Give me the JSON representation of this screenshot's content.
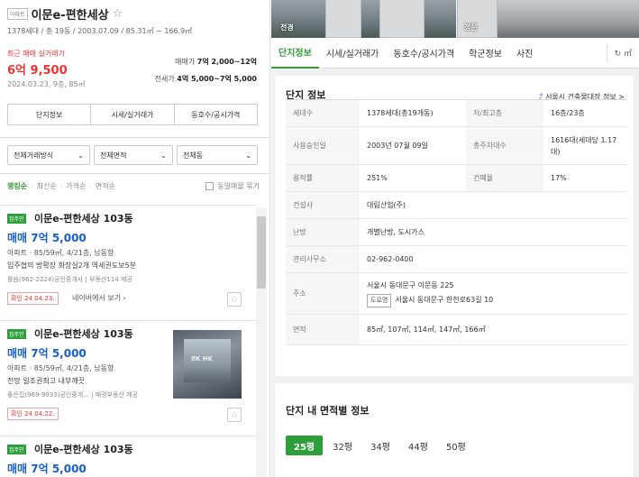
{
  "left": {
    "header": {
      "tag": "아파트",
      "title": "이문e-편한세상",
      "star": "☆",
      "meta": "1378세대 / 총 19동 / 2003.07.09 / 85.31㎡ ~ 166.9㎡"
    },
    "recent": {
      "label": "최근 매매 실거래가",
      "price": "6억 9,500",
      "date": "2024.03.23, 9층, 85㎡"
    },
    "prices": [
      {
        "label": "매매가",
        "value": "7억 2,000~12억"
      },
      {
        "label": "전세가",
        "value": "4억 5,000~7억 5,000"
      }
    ],
    "buttons": [
      "단지정보",
      "시세/실거래가",
      "동호수/공시가격"
    ],
    "filters": [
      "전체거래방식",
      "전체면적",
      "전체동"
    ],
    "sort": {
      "options": [
        "랭킹순",
        "최신순",
        "가격순",
        "면적순"
      ],
      "checkbox_label": "동일매물 묶기"
    },
    "listings": [
      {
        "badge": "집주인",
        "name": "이문e-편한세상 103동",
        "price": "매매 7억 5,000",
        "spec": "아파트 · 85/59㎡, 4/21층, 남동향",
        "desc": "입주협의 방확장 화장실2개 역세권도보5분",
        "agent": "활음(962-2224)공인중개사 | 부동산114 제공",
        "confirm": "확인 24.04.23.",
        "naver": "네이버에서 보기",
        "has_thumb": false
      },
      {
        "badge": "집주인",
        "name": "이문e-편한세상 103동",
        "price": "매매 7억 5,000",
        "spec": "아파트 · 85/59㎡, 4/21층, 남동향",
        "desc": "전망 일조권최고 내부깨끗",
        "agent": "좋은집(969-9933)공인중개... | 매경부동산 제공",
        "confirm": "확인 24.04.22.",
        "naver": "",
        "has_thumb": true,
        "thumb_text": "8K HK"
      },
      {
        "badge": "집주인",
        "name": "이문e-편한세상 103동",
        "price": "매매 7억 5,000"
      }
    ]
  },
  "right": {
    "photos": [
      {
        "caption": "전경"
      },
      {
        "caption": "정문"
      }
    ],
    "tabs": [
      "단지정보",
      "시세/실거래가",
      "동호수/공시가격",
      "학군정보",
      "사진"
    ],
    "tab_icon": "↻ ㎡",
    "info": {
      "title": "단지 정보",
      "link": "서울시 건축물대장 정보 >",
      "rows": [
        {
          "k1": "세대수",
          "v1": "1378세대(총19개동)",
          "k2": "저/최고층",
          "v2": "16층/23층"
        },
        {
          "k1": "사용승인일",
          "v1": "2003년 07월 09일",
          "k2": "총주차대수",
          "v2": "1616대(세대당 1.17대)"
        },
        {
          "k1": "용적률",
          "v1": "251%",
          "k2": "건폐율",
          "v2": "17%"
        },
        {
          "k1": "건설사",
          "v1": "대림산업(주)"
        },
        {
          "k1": "난방",
          "v1": "개별난방, 도시가스"
        },
        {
          "k1": "관리사무소",
          "v1": "02-962-0400"
        },
        {
          "k1": "주소",
          "v1": "서울시 동대문구 이문동 225",
          "road_tag": "도로명",
          "road": "서울시 동대문구 한천로63길 10"
        },
        {
          "k1": "면적",
          "v1": "85㎡, 107㎡, 114㎡, 147㎡, 166㎡"
        }
      ]
    },
    "area_info": {
      "title": "단지 내 면적별 정보",
      "pills": [
        "25평",
        "32평",
        "34평",
        "44평",
        "50평"
      ]
    }
  }
}
